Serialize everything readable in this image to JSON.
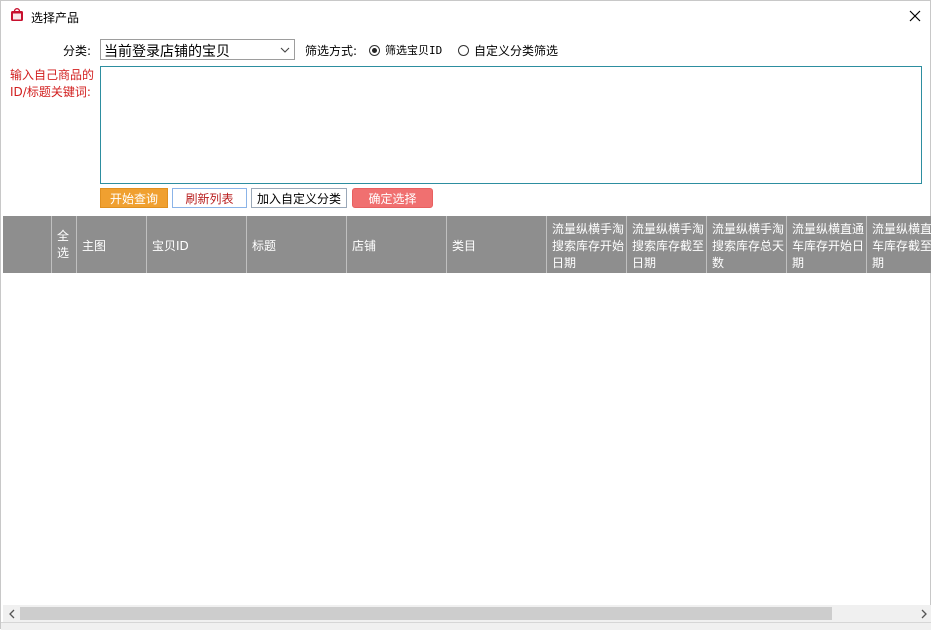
{
  "window": {
    "title": "选择产品",
    "colors": {
      "accent": "#c8102e"
    }
  },
  "form": {
    "category_label": "分类:",
    "category_value": "当前登录店铺的宝贝",
    "filter_label": "筛选方式:",
    "filter_options": [
      {
        "label": "筛选宝贝ID",
        "checked": true
      },
      {
        "label": "自定义分类筛选",
        "checked": false
      }
    ],
    "hint": "输入自己商品的ID/标题关键词:",
    "textarea_value": ""
  },
  "buttons": {
    "query": "开始查询",
    "refresh": "刷新列表",
    "add_category": "加入自定义分类",
    "confirm": "确定选择"
  },
  "table": {
    "columns": [
      "",
      "全选",
      "主图",
      "宝贝ID",
      "标题",
      "店铺",
      "类目",
      "流量纵横手淘搜索库存开始日期",
      "流量纵横手淘搜索库存截至日期",
      "流量纵横手淘搜索库存总天数",
      "流量纵横直通车库存开始日期",
      "流量纵横直通车库存截至日期"
    ],
    "rows": []
  }
}
